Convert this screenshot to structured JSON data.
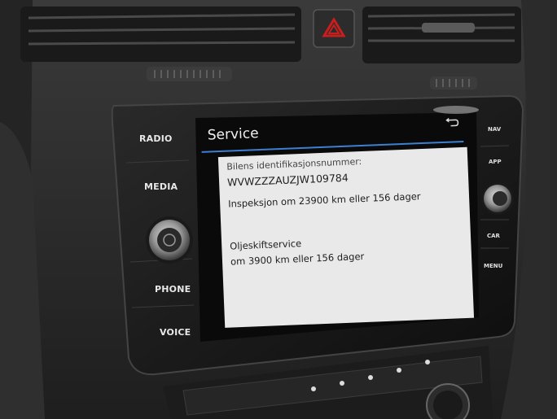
{
  "left_buttons": {
    "radio": "RADIO",
    "media": "MEDIA",
    "phone": "PHONE",
    "voice": "VOICE"
  },
  "right_buttons": {
    "nav": "NAV",
    "app": "APP",
    "car": "CAR",
    "menu": "MENU"
  },
  "screen": {
    "title": "Service",
    "back_icon": "back-arrow-icon",
    "lines": {
      "vin_label": "Bilens identifikasjonsnummer:",
      "vin_value": "WVWZZZAUZJW109784",
      "inspection": "Inspeksjon om 23900 km eller 156 dager",
      "oil_label": "Oljeskiftservice",
      "oil_value": "om 3900 km eller 156 dager"
    }
  },
  "colors": {
    "accent_line": "#3d7fd1",
    "hazard": "#c81e1e",
    "panel_bg": "#e9e9e9"
  }
}
